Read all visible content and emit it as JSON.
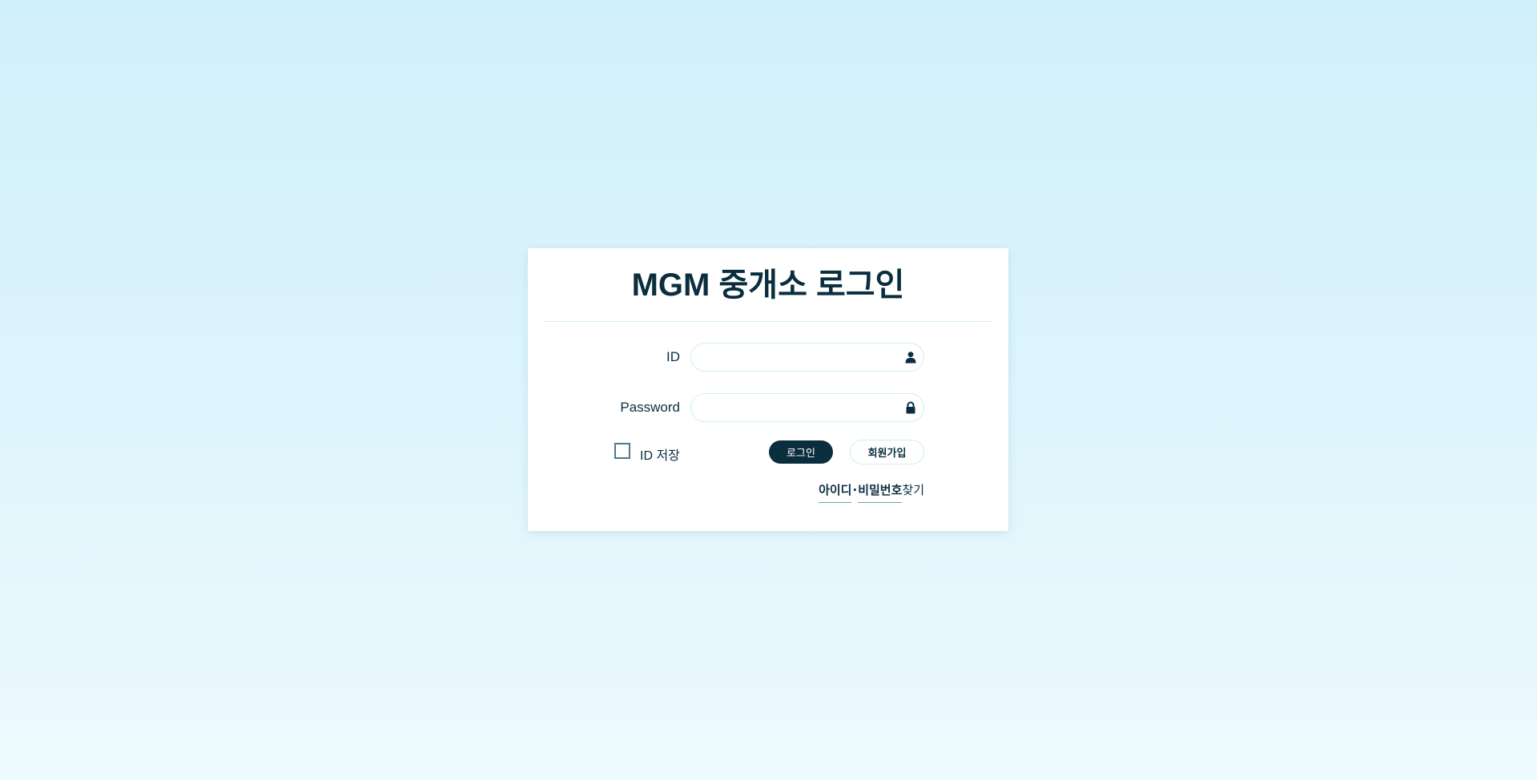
{
  "page": {
    "title": "MGM 중개소 로그인"
  },
  "form": {
    "id_label": "ID",
    "id_value": "",
    "id_icon": "user-icon",
    "password_label": "Password",
    "password_value": "",
    "password_icon": "lock-icon",
    "remember_label": "ID 저장",
    "remember_checked": false
  },
  "actions": {
    "login_label": "로그인",
    "signup_label": "회원가입",
    "find_id": "아이디",
    "find_separator": "·",
    "find_password": "비밀번호",
    "find_suffix": "찾기"
  },
  "colors": {
    "primary": "#0b2e3f",
    "border": "#cdeef7",
    "background_top": "#d0f0fa",
    "background_bottom": "#eefafe"
  }
}
